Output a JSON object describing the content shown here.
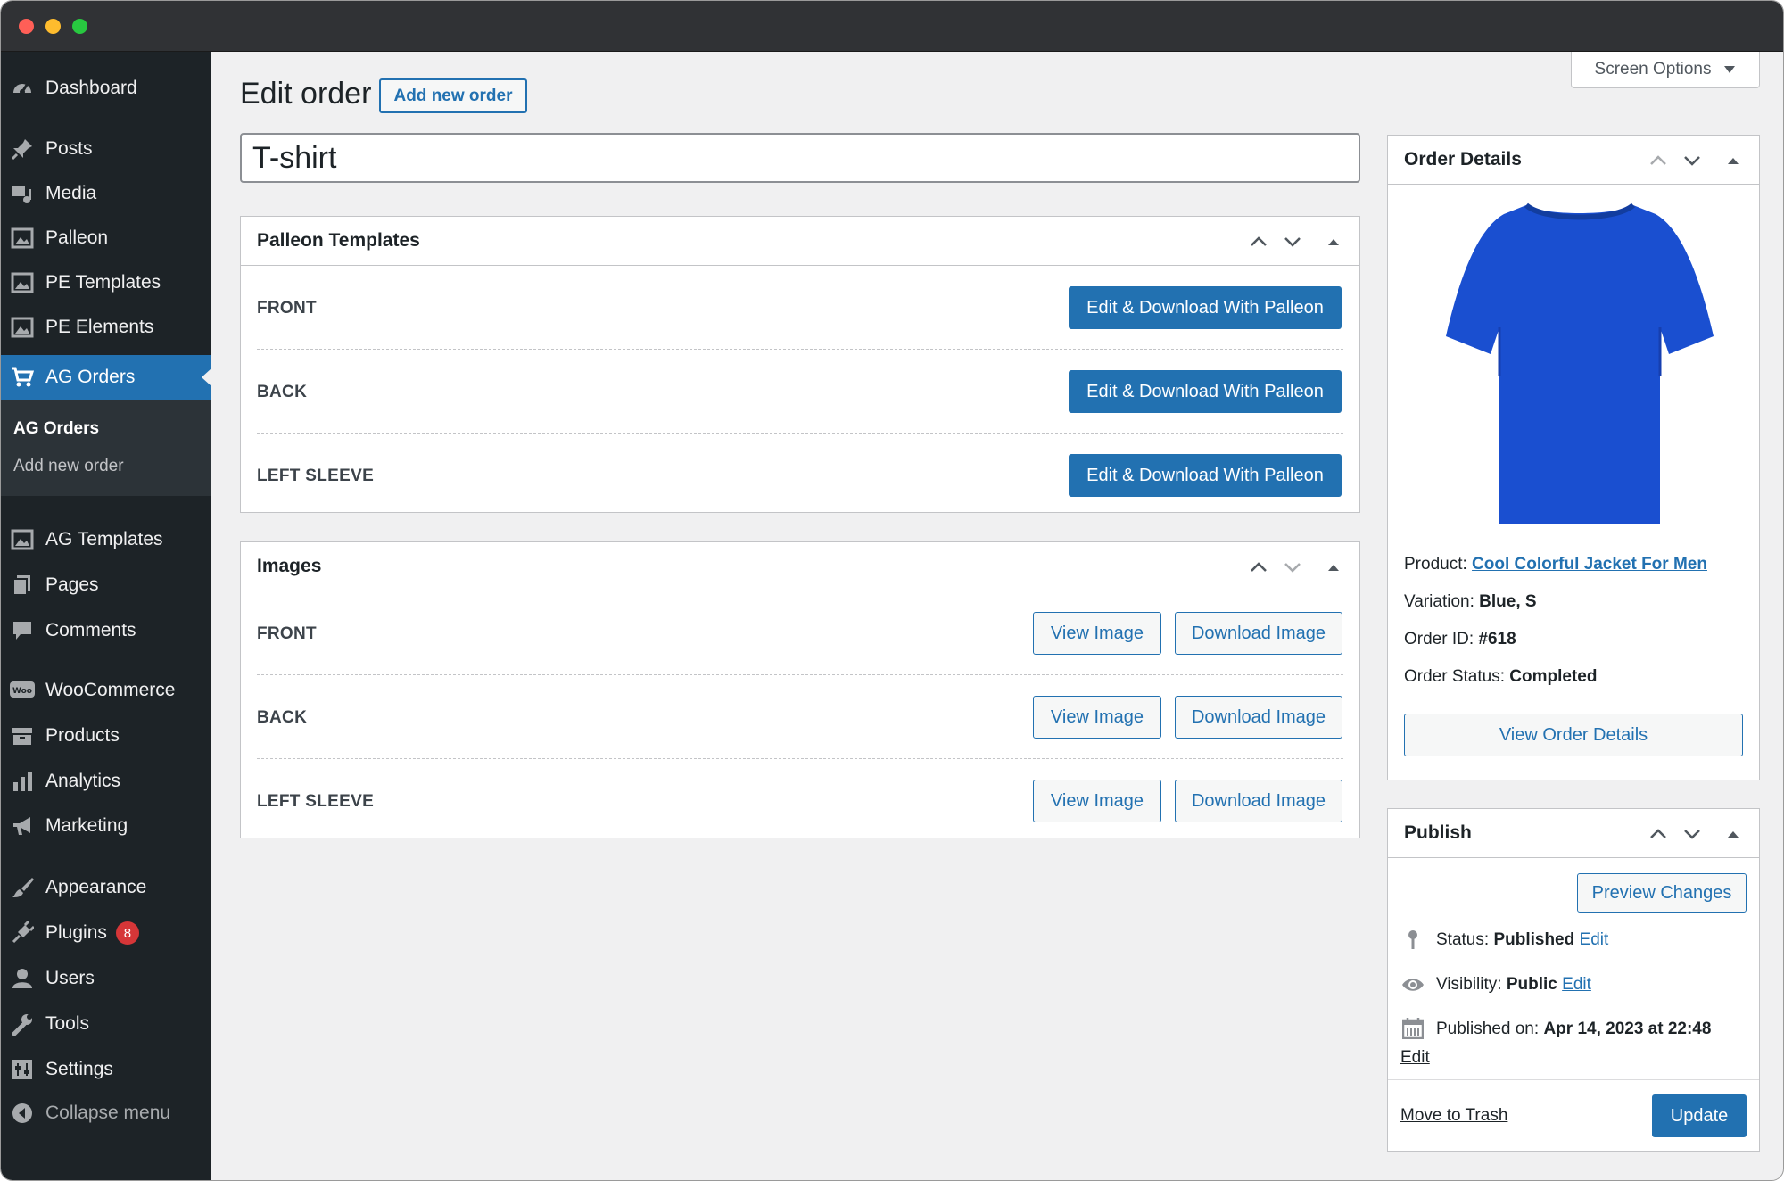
{
  "sidebar": {
    "items": [
      {
        "label": "Dashboard",
        "icon": "dashboard-icon"
      },
      {
        "label": "Posts",
        "icon": "pin-icon"
      },
      {
        "label": "Media",
        "icon": "media-icon"
      },
      {
        "label": "Palleon",
        "icon": "image-icon"
      },
      {
        "label": "PE Templates",
        "icon": "image-icon"
      },
      {
        "label": "PE Elements",
        "icon": "image-icon"
      },
      {
        "label": "AG Orders",
        "icon": "cart-icon"
      },
      {
        "label": "AG Templates",
        "icon": "image-icon"
      },
      {
        "label": "Pages",
        "icon": "pages-icon"
      },
      {
        "label": "Comments",
        "icon": "comment-icon"
      },
      {
        "label": "WooCommerce",
        "icon": "woo-icon"
      },
      {
        "label": "Products",
        "icon": "archive-icon"
      },
      {
        "label": "Analytics",
        "icon": "chart-icon"
      },
      {
        "label": "Marketing",
        "icon": "megaphone-icon"
      },
      {
        "label": "Appearance",
        "icon": "brush-icon"
      },
      {
        "label": "Plugins",
        "icon": "plugin-icon",
        "badge": "8"
      },
      {
        "label": "Users",
        "icon": "user-icon"
      },
      {
        "label": "Tools",
        "icon": "wrench-icon"
      },
      {
        "label": "Settings",
        "icon": "settings-icon"
      }
    ],
    "submenu": {
      "current": "AG Orders",
      "add_new": "Add new order"
    },
    "collapse": "Collapse menu"
  },
  "header": {
    "title": "Edit order",
    "add_new": "Add new order",
    "screen_options": "Screen Options"
  },
  "title_input": {
    "value": "T-shirt"
  },
  "templates_box": {
    "title": "Palleon Templates",
    "button_label": "Edit & Download With Palleon",
    "rows": [
      "FRONT",
      "BACK",
      "LEFT SLEEVE"
    ]
  },
  "images_box": {
    "title": "Images",
    "view_label": "View Image",
    "download_label": "Download Image",
    "rows": [
      "FRONT",
      "BACK",
      "LEFT SLEEVE"
    ]
  },
  "order_details": {
    "title": "Order Details",
    "product_label": "Product:",
    "product_value": "Cool Colorful Jacket For Men",
    "variation_label": "Variation:",
    "variation_value": "Blue, S",
    "order_id_label": "Order ID:",
    "order_id_value": "#618",
    "status_label": "Order Status:",
    "status_value": "Completed",
    "button": "View Order Details",
    "shirt_color": "#1a4fd0"
  },
  "publish": {
    "title": "Publish",
    "preview": "Preview Changes",
    "status_label": "Status:",
    "status_value": "Published",
    "visibility_label": "Visibility:",
    "visibility_value": "Public",
    "published_label": "Published on:",
    "published_value": "Apr 14, 2023 at 22:48",
    "edit": "Edit",
    "trash": "Move to Trash",
    "update": "Update"
  },
  "colors": {
    "accent": "#2271b1",
    "sidebar": "#1d2327",
    "danger": "#b32d2e"
  }
}
